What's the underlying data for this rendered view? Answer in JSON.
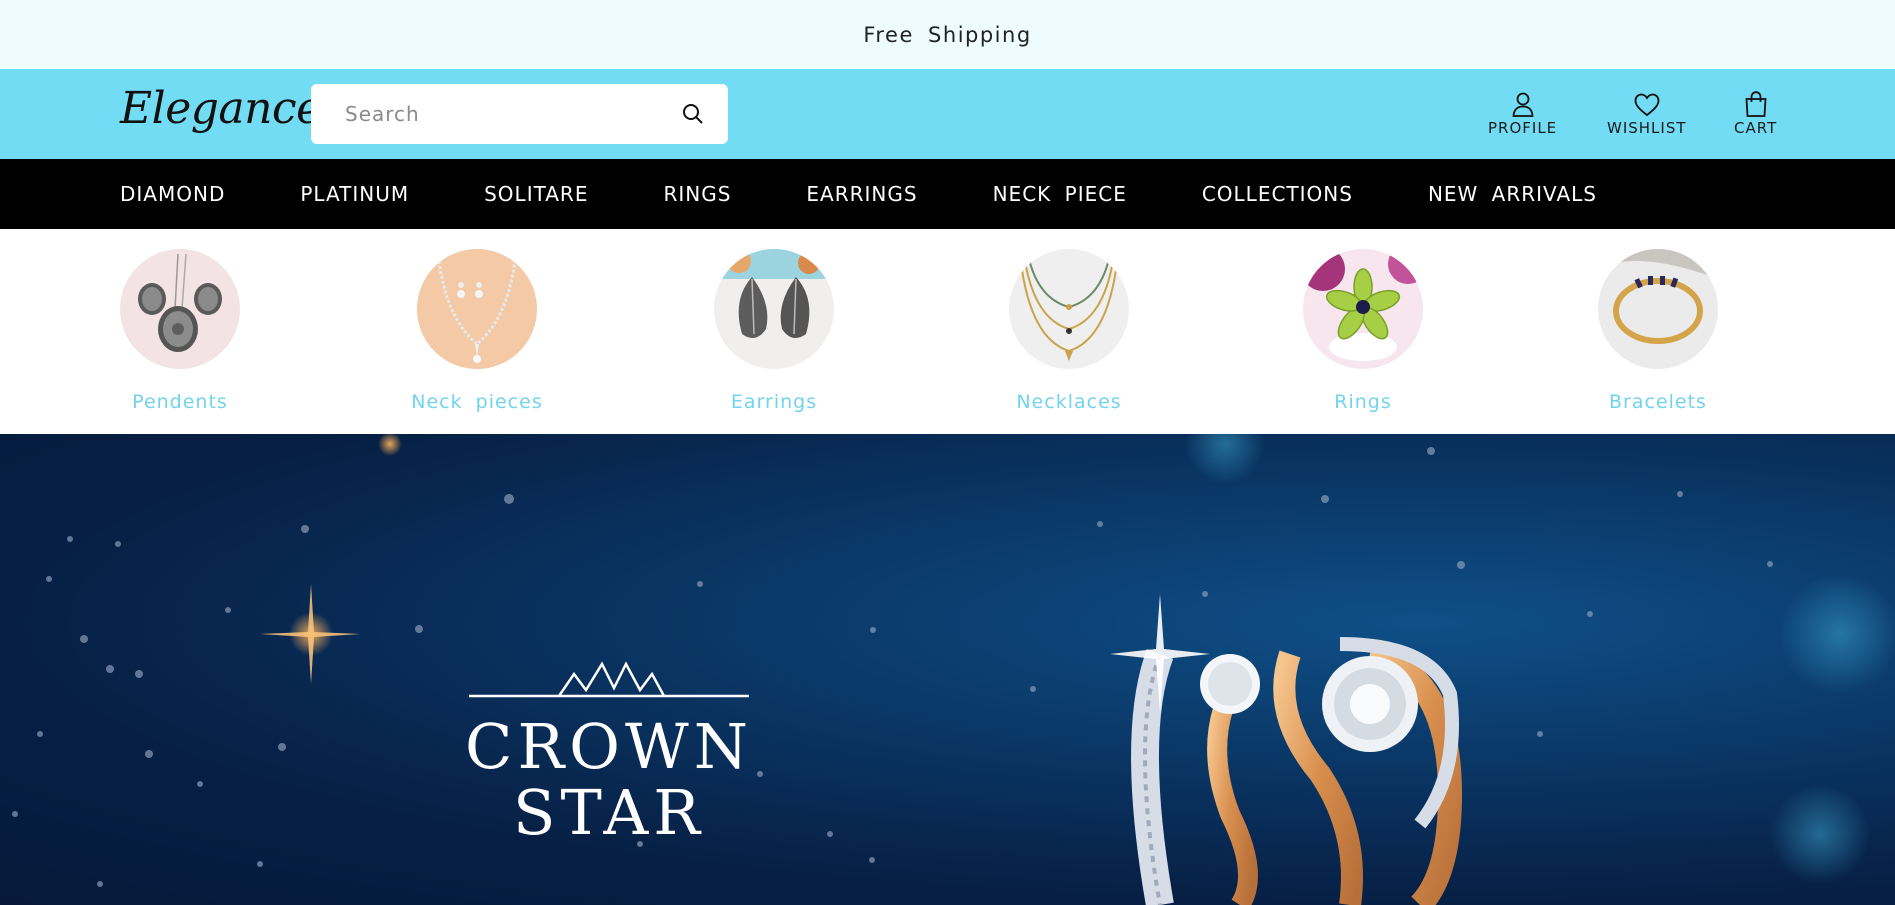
{
  "announcement": {
    "text": "Free Shipping"
  },
  "header": {
    "logo": "Elegance",
    "search": {
      "placeholder": "Search",
      "value": ""
    },
    "actions": [
      {
        "label": "PROFILE",
        "icon": "user-icon"
      },
      {
        "label": "WISHLIST",
        "icon": "heart-icon"
      },
      {
        "label": "CART",
        "icon": "shopping-bag-icon"
      }
    ]
  },
  "nav": {
    "items": [
      "DIAMOND",
      "PLATINUM",
      "SOLITARE",
      "RINGS",
      "EARRINGS",
      "NECK PIECE",
      "COLLECTIONS",
      "NEW ARRIVALS"
    ]
  },
  "categories": [
    {
      "label": "Pendents",
      "image": "pendant-image"
    },
    {
      "label": "Neck pieces",
      "image": "necklace-set-image"
    },
    {
      "label": "Earrings",
      "image": "leaf-earrings-image"
    },
    {
      "label": "Necklaces",
      "image": "layered-necklace-image"
    },
    {
      "label": "Rings",
      "image": "flower-ring-image"
    },
    {
      "label": "Bracelets",
      "image": "bracelet-image"
    }
  ],
  "hero": {
    "title_line1": "CROWN",
    "title_line2": "STAR",
    "image": "gold-diamond-rings-image"
  },
  "colors": {
    "announcement_bg": "#effcfd",
    "header_bg": "#72dcf4",
    "nav_bg": "#000000",
    "category_label": "#72d4ec",
    "hero_bg": "#0a3766"
  }
}
